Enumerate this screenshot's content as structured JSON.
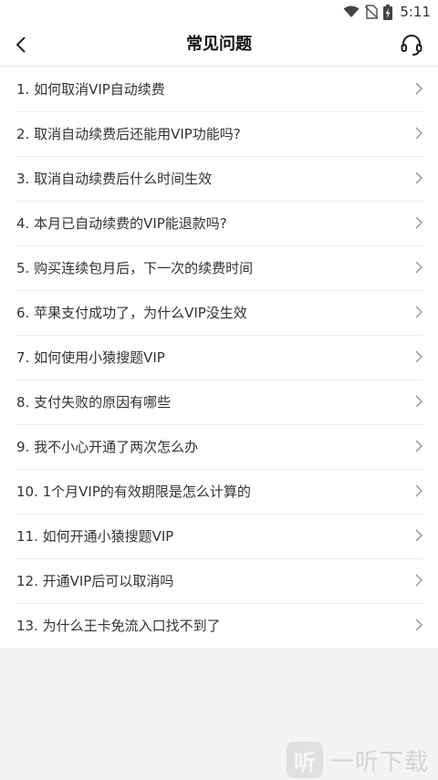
{
  "status": {
    "time": "5:11"
  },
  "header": {
    "title": "常见问题"
  },
  "faq": [
    "1. 如何取消VIP自动续费",
    "2. 取消自动续费后还能用VIP功能吗?",
    "3. 取消自动续费后什么时间生效",
    "4. 本月已自动续费的VIP能退款吗?",
    "5. 购买连续包月后，下一次的续费时间",
    "6. 苹果支付成功了，为什么VIP没生效",
    "7. 如何使用小猿搜题VIP",
    "8. 支付失败的原因有哪些",
    "9. 我不小心开通了两次怎么办",
    "10. 1个月VIP的有效期限是怎么计算的",
    "11. 如何开通小猿搜题VIP",
    "12. 开通VIP后可以取消吗",
    "13. 为什么王卡免流入口找不到了"
  ],
  "watermark": {
    "logo": "听",
    "text": "一听下载"
  }
}
